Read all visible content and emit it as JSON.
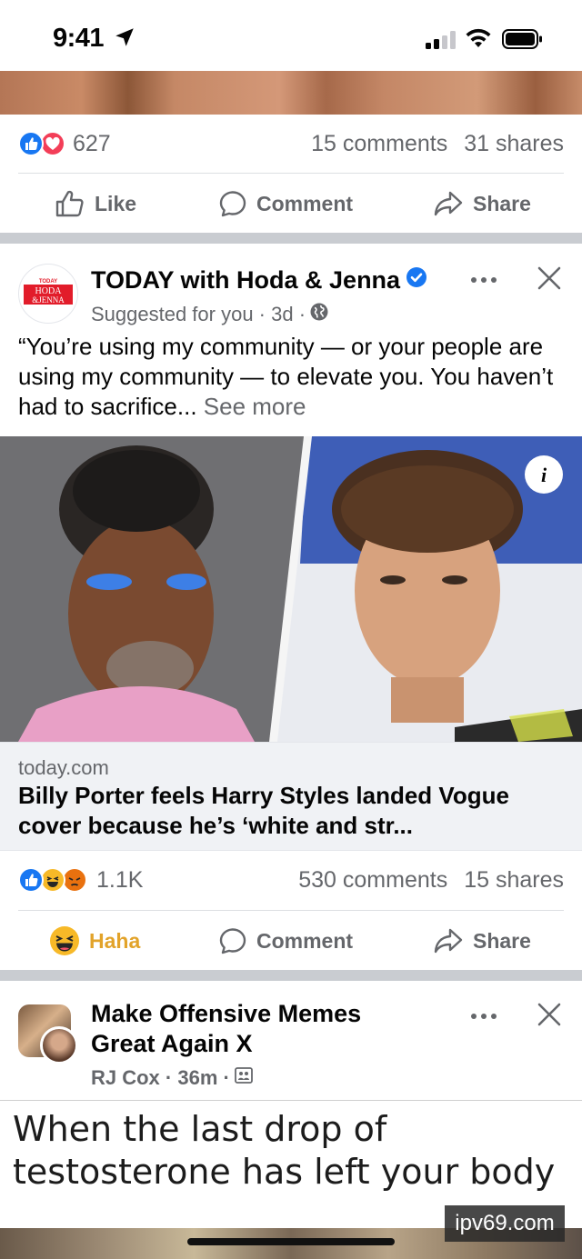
{
  "status_bar": {
    "time": "9:41"
  },
  "post1": {
    "reaction_count": "627",
    "comments": "15 comments",
    "shares": "31 shares",
    "actions": {
      "like": "Like",
      "comment": "Comment",
      "share": "Share"
    }
  },
  "post2": {
    "avatar_text": {
      "top": "TODAY",
      "line1": "HODA",
      "line2": "&JENNA"
    },
    "page_name": "TODAY with Hoda & Jenna",
    "meta": "Suggested for you · 3d ·",
    "text": "“You’re using my community — or your people are using my community — to elevate you. You haven’t had to sacrifice...",
    "see_more": "See more",
    "link_domain": "today.com",
    "link_title": "Billy Porter feels Harry Styles landed Vogue cover because he’s ‘white and str...",
    "reaction_count": "1.1K",
    "comments": "530 comments",
    "shares": "15 shares",
    "actions": {
      "haha": "Haha",
      "comment": "Comment",
      "share": "Share"
    }
  },
  "post3": {
    "page_name_line1": "Make Offensive Memes",
    "page_name_line2": "Great Again X",
    "meta": "RJ Cox · 36m ·",
    "meme_line1": "When the last drop of",
    "meme_line2": "testosterone has left your body"
  },
  "watermark": "ipv69.com",
  "colors": {
    "facebook_blue": "#1877f2",
    "love_red": "#f33e58",
    "haha_yellow": "#f7b928",
    "angry_orange": "#e9710f",
    "secondary_text": "#65676b",
    "separator": "#c9ccd1"
  }
}
